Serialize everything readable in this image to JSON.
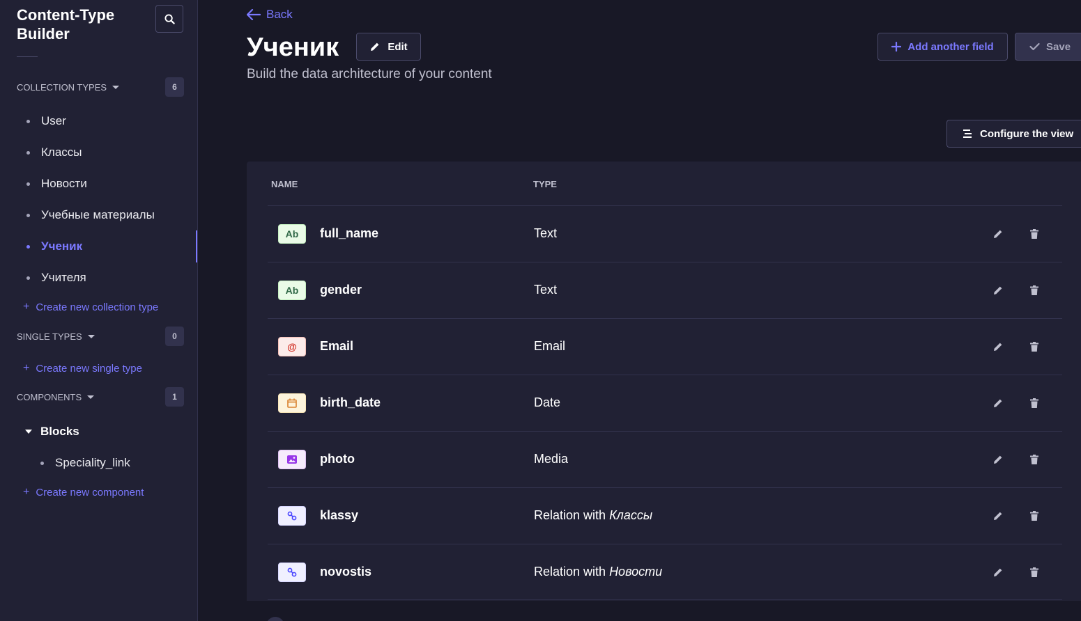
{
  "sidebar": {
    "title": "Content-Type Builder",
    "collection_types": {
      "label": "COLLECTION TYPES",
      "count": "6",
      "items": [
        "User",
        "Классы",
        "Новости",
        "Учебные материалы",
        "Ученик",
        "Учителя"
      ],
      "active": "Ученик",
      "create_label": "Create new collection type"
    },
    "single_types": {
      "label": "SINGLE TYPES",
      "count": "0",
      "create_label": "Create new single type"
    },
    "components": {
      "label": "COMPONENTS",
      "count": "1",
      "group": "Blocks",
      "items": [
        "Speciality_link"
      ],
      "create_label": "Create new component"
    }
  },
  "header": {
    "back_label": "Back",
    "title": "Ученик",
    "edit_label": "Edit",
    "subtitle": "Build the data architecture of your content",
    "add_field_label": "Add another field",
    "save_label": "Save",
    "configure_label": "Configure the view"
  },
  "table": {
    "columns": [
      "NAME",
      "TYPE"
    ],
    "rows": [
      {
        "icon": "text-icon",
        "icon_glyph": "Ab",
        "name": "full_name",
        "type": "Text",
        "target": ""
      },
      {
        "icon": "text-icon",
        "icon_glyph": "Ab",
        "name": "gender",
        "type": "Text",
        "target": ""
      },
      {
        "icon": "email-icon",
        "icon_glyph": "@",
        "name": "Email",
        "type": "Email",
        "target": ""
      },
      {
        "icon": "calendar-icon",
        "icon_glyph": "",
        "name": "birth_date",
        "type": "Date",
        "target": ""
      },
      {
        "icon": "media-icon",
        "icon_glyph": "",
        "name": "photo",
        "type": "Media",
        "target": ""
      },
      {
        "icon": "relation-icon",
        "icon_glyph": "",
        "name": "klassy",
        "type": "Relation with ",
        "target": "Классы"
      },
      {
        "icon": "relation-icon",
        "icon_glyph": "",
        "name": "novostis",
        "type": "Relation with ",
        "target": "Новости"
      }
    ]
  },
  "colors": {
    "accent": "#7b79ff",
    "background": "#181826",
    "surface": "#212134",
    "border": "#32324d"
  }
}
